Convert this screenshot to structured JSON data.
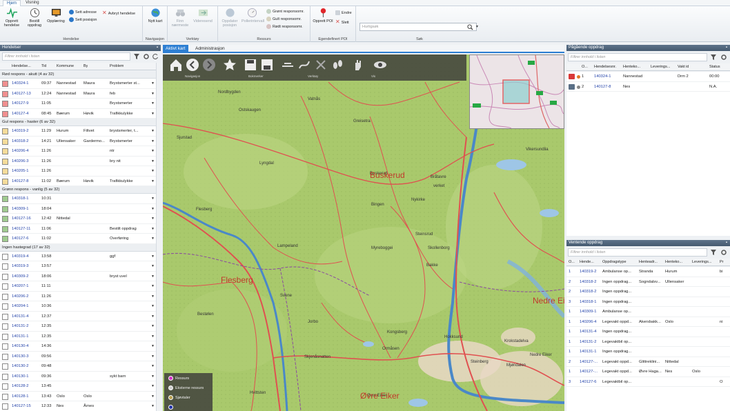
{
  "ribbon_tabs": [
    "Hjem",
    "Visning"
  ],
  "ribbon": {
    "hendelse": {
      "label": "Hendelse",
      "opprett": "Opprett hendelse",
      "bestill": "Bestill oppdrag",
      "oppleering": "Opplæring",
      "sett_adresse": "Sett adresse",
      "sett_posisjon": "Sett posisjon",
      "avbryt": "Avbryt hendelse"
    },
    "navigasjon": {
      "label": "Navigasjon",
      "nytt_kart": "Nytt kart"
    },
    "verktoy": {
      "label": "Verktøy",
      "finn": "Finn nærmeste",
      "videresend": "Videresend"
    },
    "ressurs": {
      "label": "Ressurs",
      "oppdater": "Oppdater posisjon",
      "pollerintervall": "Pollerintervall",
      "gront": "Grønt responsomr.",
      "gult": "Gult responsomr.",
      "rodt": "Rødt responsomr."
    },
    "poi": {
      "label": "Egendefinert POI",
      "opprett": "Opprett POI",
      "endre": "Endre",
      "slett": "Slett"
    },
    "sok": {
      "label": "Søk",
      "placeholder": "Hurtigsøk"
    }
  },
  "hendelser": {
    "title": "Hendelser",
    "filter": "Filtrer innhold i listen",
    "columns": [
      "Hendelse...",
      "Tid",
      "Kommune",
      "By",
      "Problem"
    ],
    "groups": [
      {
        "label": "Rød respons - akutt (4 av 32)",
        "color": "#f08f8f",
        "rows": [
          [
            "140324-1",
            "09:37",
            "Nannestad",
            "Maura",
            "Brystsmerter st..."
          ],
          [
            "140127-13",
            "12:24",
            "Nannestad",
            "Maura",
            "feb"
          ],
          [
            "140127-9",
            "11:05",
            "",
            "",
            "Brystsmerter"
          ],
          [
            "140127-4",
            "08:45",
            "Bærum",
            "Høvik",
            "Trafikkulykke"
          ]
        ]
      },
      {
        "label": "Gul respons - haster (6 av 32)",
        "color": "#f5dc9a",
        "rows": [
          [
            "140319-2",
            "11:29",
            "Hurum",
            "Filtvet",
            "brystsmerter, t..."
          ],
          [
            "140318-2",
            "14:21",
            "Ullensaker",
            "Gardermo...",
            "Brystsmerter"
          ],
          [
            "140206-4",
            "11:26",
            "",
            "",
            "ntr"
          ],
          [
            "140206-3",
            "11:26",
            "",
            "",
            "bry nit"
          ],
          [
            "140205-1",
            "11:26",
            "",
            "",
            ""
          ],
          [
            "140127-8",
            "11:02",
            "Bærum",
            "Høvik",
            "Trafikkulykke"
          ]
        ]
      },
      {
        "label": "Grønn respons - vanlig (5 av 32)",
        "color": "#9fcb8f",
        "rows": [
          [
            "140318-1",
            "10:31",
            "",
            "",
            ""
          ],
          [
            "140309-1",
            "18:04",
            "",
            "",
            ""
          ],
          [
            "140127-16",
            "12:42",
            "Nittedal",
            "",
            ""
          ],
          [
            "140127-11",
            "11:06",
            "",
            "",
            "Bestilt oppdrag"
          ],
          [
            "140127-6",
            "11:02",
            "",
            "",
            "Overføring"
          ]
        ]
      },
      {
        "label": "Ingen hastegrad (17 av 32)",
        "color": "#ffffff",
        "rows": [
          [
            "140319-4",
            "13:58",
            "",
            "",
            "ggf"
          ],
          [
            "140319-3",
            "13:57",
            "",
            "",
            ""
          ],
          [
            "140309-2",
            "18:06",
            "",
            "",
            "bryst uvel"
          ],
          [
            "140207-1",
            "11:11",
            "",
            "",
            ""
          ],
          [
            "140206-2",
            "11:26",
            "",
            "",
            ""
          ],
          [
            "140204-1",
            "10:36",
            "",
            "",
            ""
          ],
          [
            "140131-4",
            "12:37",
            "",
            "",
            ""
          ],
          [
            "140131-2",
            "12:35",
            "",
            "",
            ""
          ],
          [
            "140131-1",
            "12:35",
            "",
            "",
            ""
          ],
          [
            "140130-4",
            "14:36",
            "",
            "",
            ""
          ],
          [
            "140130-3",
            "09:56",
            "",
            "",
            ""
          ],
          [
            "140130-2",
            "09:48",
            "",
            "",
            ""
          ],
          [
            "140130-1",
            "09:36",
            "",
            "",
            "sykt barn"
          ],
          [
            "140128-2",
            "13:45",
            "",
            "",
            ""
          ],
          [
            "140128-1",
            "13:43",
            "Oslo",
            "Oslo",
            ""
          ],
          [
            "140127-15",
            "12:33",
            "Nes",
            "Årnes",
            ""
          ]
        ]
      }
    ]
  },
  "map": {
    "tabs": [
      "Aktivt kart",
      "Administrasjon"
    ],
    "toolbar_labels": [
      "Navigasjon",
      "Bokmerker",
      "Verktøy",
      "Vis"
    ],
    "labels": [
      "Nordbygden",
      "Ostskaugen",
      "Vatnås",
      "Greisetra",
      "Sjurstad",
      "Lyngdal",
      "Buskerud",
      "Bråtavre",
      "verket",
      "Nykirke",
      "Bingen",
      "Steinsrud",
      "Flesberg",
      "Lampeland",
      "Myreboggei",
      "Skollenborg",
      "Bakke",
      "Bestølen",
      "Svene",
      "Hvittsten",
      "Jorbo",
      "Kongsberg",
      "Hokksund",
      "Ormåsen",
      "Krokstadelva",
      "Steinberg",
      "Mjøndalen",
      "Øvre Eiker",
      "Nedre Eiker",
      "Skjenåsnatten",
      "Vikersundlia"
    ],
    "big_labels": [
      "Buskerud",
      "Flesberg",
      "Øvre Eiker",
      "Nedre Eiker"
    ],
    "legend": [
      {
        "label": "Ressurs",
        "color": "#d633c8"
      },
      {
        "label": "Eksterne ressurs",
        "color": "#d0d0d0"
      },
      {
        "label": "Sjøvtaler",
        "color": "#b8a050"
      },
      {
        "label": "",
        "color": "#2233aa"
      }
    ]
  },
  "pagaende": {
    "title": "Pågående oppdrag",
    "filter": "Filtrer innhold i listen",
    "columns": [
      "O...",
      "Hendelsesnr.",
      "Henteko...",
      "Leverings...",
      "Vakt id",
      "Status"
    ],
    "rows": [
      [
        "1",
        "140324-1",
        "Nannestad",
        "",
        "Drm 2",
        "00:00"
      ],
      [
        "2",
        "140127-8",
        "Nes",
        "",
        "",
        "N.A."
      ]
    ]
  },
  "ventende": {
    "title": "Ventende oppdrag",
    "filter": "Filtrer innhold i listen",
    "columns": [
      "O...",
      "Hende...",
      "Oppdragstype",
      "Henteadr...",
      "Henteko...",
      "Leverings...",
      "Pr"
    ],
    "rows": [
      [
        "1",
        "140319-2",
        "Ambulanse op...",
        "Stranda",
        "Hurum",
        "",
        "bi"
      ],
      [
        "2",
        "140318-2",
        "Ingen oppdrag...",
        "Sogndalsv...",
        "Ullensaker",
        "",
        ""
      ],
      [
        "2",
        "140318-2",
        "Ingen oppdrag...",
        "",
        "",
        "",
        ""
      ],
      [
        "3",
        "140318-1",
        "Ingen oppdrag...",
        "",
        "",
        "",
        ""
      ],
      [
        "1",
        "140309-1",
        "Ambulanse op...",
        "",
        "",
        "",
        ""
      ],
      [
        "1",
        "140206-4",
        "Legevakt oppd...",
        "Akersbakk...",
        "Oslo",
        "",
        "ni"
      ],
      [
        "1",
        "140131-4",
        "Ingen oppdrag...",
        "",
        "",
        "",
        ""
      ],
      [
        "1",
        "140131-2",
        "Legevaktbil op...",
        "",
        "",
        "",
        ""
      ],
      [
        "1",
        "140131-1",
        "Ingen oppdrag...",
        "",
        "",
        "",
        ""
      ],
      [
        "2",
        "140127-...",
        "Legevakt oppd...",
        "Glittreklini...",
        "Nittedal",
        "",
        ""
      ],
      [
        "1",
        "140127-...",
        "Legevakt oppd...",
        "Øvre Haga...",
        "Nes",
        "Oslo",
        ""
      ],
      [
        "3",
        "140127-6",
        "Legevaktbil op...",
        "",
        "",
        "",
        "O"
      ]
    ]
  },
  "colors": {
    "header": "#4d6278",
    "accent": "#2d7fd3",
    "link": "#1f3fa8"
  }
}
